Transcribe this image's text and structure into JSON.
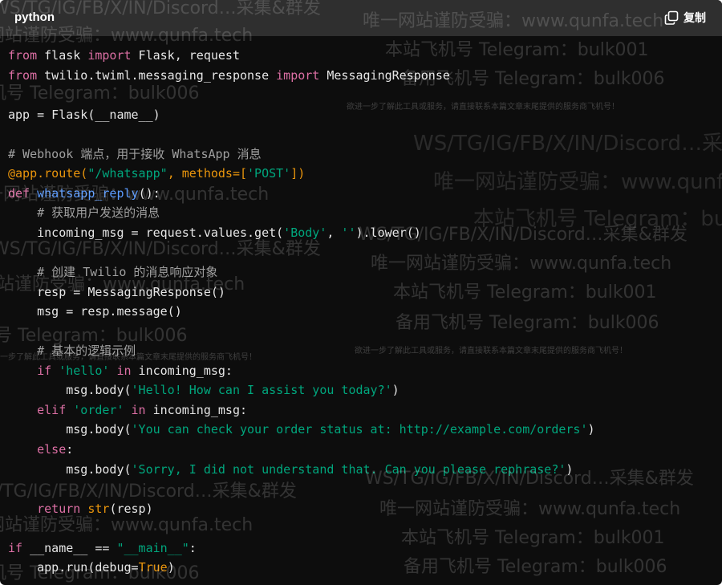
{
  "header": {
    "language": "python",
    "copy_label": "复制"
  },
  "colors": {
    "keyword": "#dc6fa4",
    "string": "#00a67d",
    "builtin": "#e9950c",
    "comment": "#a0a0a0",
    "text": "#e6e6e6",
    "function": "#5a9bff"
  },
  "code_lines": [
    [
      [
        "from",
        "kw"
      ],
      [
        " flask ",
        "tx"
      ],
      [
        "import",
        "kw"
      ],
      [
        " Flask, request",
        "tx"
      ]
    ],
    [
      [
        "from",
        "kw"
      ],
      [
        " twilio.twiml.messaging_response ",
        "tx"
      ],
      [
        "import",
        "kw"
      ],
      [
        " MessagingResponse",
        "tx"
      ]
    ],
    [],
    [
      [
        "app = Flask(__name__)",
        "tx"
      ]
    ],
    [],
    [
      [
        "# Webhook 端点，用于接收 WhatsApp 消息",
        "cm"
      ]
    ],
    [
      [
        "@app.route(",
        "bi"
      ],
      [
        "\"/whatsapp\"",
        "st"
      ],
      [
        ", methods=[",
        "bi"
      ],
      [
        "'POST'",
        "st"
      ],
      [
        "])",
        "bi"
      ]
    ],
    [
      [
        "def",
        "kw"
      ],
      [
        " ",
        "tx"
      ],
      [
        "whatsapp_reply",
        "fn"
      ],
      [
        "():",
        "tx"
      ]
    ],
    [
      [
        "    ",
        "tx"
      ],
      [
        "# 获取用户发送的消息",
        "cm"
      ]
    ],
    [
      [
        "    incoming_msg = request.values.get(",
        "tx"
      ],
      [
        "'Body'",
        "st"
      ],
      [
        ", ",
        "tx"
      ],
      [
        "''",
        "st"
      ],
      [
        ").lower()",
        "tx"
      ]
    ],
    [],
    [
      [
        "    ",
        "tx"
      ],
      [
        "# 创建 Twilio 的消息响应对象",
        "cm"
      ]
    ],
    [
      [
        "    resp = MessagingResponse()",
        "tx"
      ]
    ],
    [
      [
        "    msg = resp.message()",
        "tx"
      ]
    ],
    [],
    [
      [
        "    ",
        "tx"
      ],
      [
        "# 基本的逻辑示例",
        "cm"
      ]
    ],
    [
      [
        "    ",
        "tx"
      ],
      [
        "if",
        "kw"
      ],
      [
        " ",
        "tx"
      ],
      [
        "'hello'",
        "st"
      ],
      [
        " ",
        "tx"
      ],
      [
        "in",
        "kw"
      ],
      [
        " incoming_msg:",
        "tx"
      ]
    ],
    [
      [
        "        msg.body(",
        "tx"
      ],
      [
        "'Hello! How can I assist you today?'",
        "st"
      ],
      [
        ")",
        "tx"
      ]
    ],
    [
      [
        "    ",
        "tx"
      ],
      [
        "elif",
        "kw"
      ],
      [
        " ",
        "tx"
      ],
      [
        "'order'",
        "st"
      ],
      [
        " ",
        "tx"
      ],
      [
        "in",
        "kw"
      ],
      [
        " incoming_msg:",
        "tx"
      ]
    ],
    [
      [
        "        msg.body(",
        "tx"
      ],
      [
        "'You can check your order status at: http://example.com/orders'",
        "st"
      ],
      [
        ")",
        "tx"
      ]
    ],
    [
      [
        "    ",
        "tx"
      ],
      [
        "else",
        "kw"
      ],
      [
        ":",
        "tx"
      ]
    ],
    [
      [
        "        msg.body(",
        "tx"
      ],
      [
        "'Sorry, I did not understand that. Can you please rephrase?'",
        "st"
      ],
      [
        ")",
        "tx"
      ]
    ],
    [],
    [
      [
        "    ",
        "tx"
      ],
      [
        "return",
        "kw"
      ],
      [
        " ",
        "tx"
      ],
      [
        "str",
        "bi"
      ],
      [
        "(resp)",
        "tx"
      ]
    ],
    [],
    [
      [
        "if",
        "kw"
      ],
      [
        " __name__ == ",
        "tx"
      ],
      [
        "\"__main__\"",
        "st"
      ],
      [
        ":",
        "tx"
      ]
    ],
    [
      [
        "    app.run(debug=",
        "tx"
      ],
      [
        "True",
        "bi"
      ],
      [
        ")",
        "tx"
      ]
    ]
  ],
  "watermarks": [
    "WS/TG/IG/FB/X/IN/Discord…采集&群发",
    "唯一网站谨防受骗：www.qunfa.tech",
    "本站飞机号 Telegram：bulk001",
    "备用飞机号 Telegram：bulk006",
    "欲进一步了解此工具或服务，请直接联系本篇文章末尾提供的服务商飞机号！"
  ]
}
